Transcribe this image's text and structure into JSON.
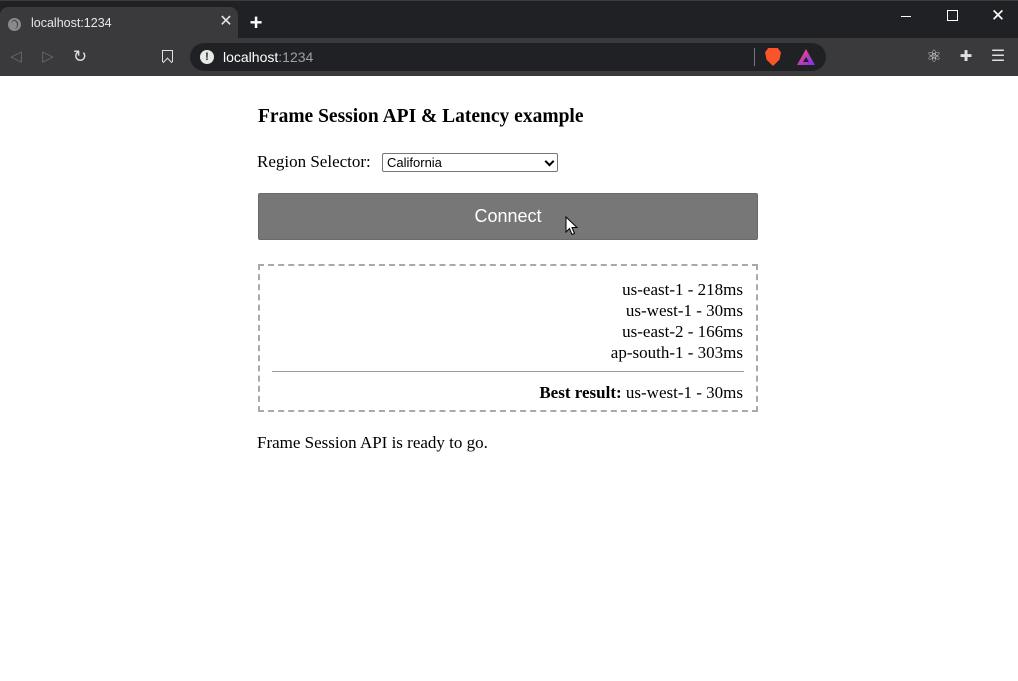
{
  "browser": {
    "tab": {
      "title": "localhost:1234",
      "close_glyph": "✕",
      "favicon": "globe-icon"
    },
    "new_tab_glyph": "+",
    "window_controls": {
      "close_glyph": "✕"
    },
    "address": {
      "host": "localhost",
      "port": ":1234",
      "security": "info-icon",
      "security_glyph": "!"
    },
    "toolbar_glyphs": {
      "back": "◁",
      "forward": "▷",
      "reload": "↻",
      "react": "⚛",
      "extensions": "✚",
      "menu": "☰"
    }
  },
  "page": {
    "heading": "Frame Session API & Latency example",
    "region_label": "Region Selector:",
    "region_selected": "California",
    "connect_label": "Connect",
    "latency": [
      "us-east-1 - 218ms",
      "us-west-1 - 30ms",
      "us-east-2 - 166ms",
      "ap-south-1 - 303ms"
    ],
    "best_label": "Best result:",
    "best_value": " us-west-1 - 30ms",
    "status": "Frame Session API is ready to go."
  },
  "colors": {
    "chrome_dark": "#202124",
    "chrome_tab": "#3a3a3c",
    "connect_button": "#777777",
    "box_border": "#a9a9a9"
  }
}
